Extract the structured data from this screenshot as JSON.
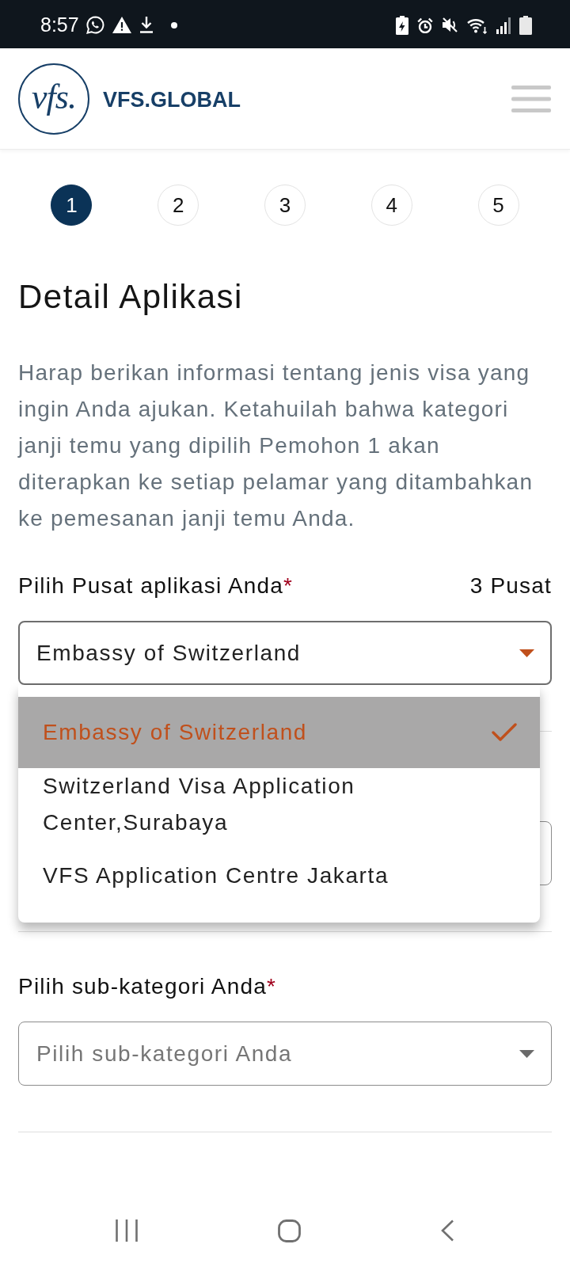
{
  "status_bar": {
    "time": "8:57"
  },
  "header": {
    "logo": "vfs.",
    "brand": "VFS.GLOBAL"
  },
  "steps": [
    {
      "label": "1",
      "selected": true
    },
    {
      "label": "2",
      "selected": false
    },
    {
      "label": "3",
      "selected": false
    },
    {
      "label": "4",
      "selected": false
    },
    {
      "label": "5",
      "selected": false
    }
  ],
  "title": "Detail Aplikasi",
  "intro": "Harap berikan informasi tentang jenis visa yang ingin Anda ajukan. Ketahuilah bahwa kategori janji temu yang dipilih Pemohon 1 akan diterapkan ke setiap pelamar yang ditambahkan ke pemesanan janji temu Anda.",
  "fields": [
    {
      "kind": "select",
      "label": "Pilih Pusat aplikasi Anda",
      "required_mark": "*",
      "count": "3 Pusat",
      "value": "Embassy of Switzerland",
      "expanded": true,
      "options": [
        {
          "label": "Embassy of Switzerland",
          "selected": true
        },
        {
          "label": "Switzerland Visa Application Center,Surabaya",
          "selected": false
        },
        {
          "label": "VFS Application Centre Jakarta",
          "selected": false
        }
      ]
    },
    {
      "kind": "select"
    },
    {
      "kind": "select",
      "label": "Pilih sub-kategori Anda",
      "required_mark": "*",
      "placeholder": "Pilih sub-kategori Anda",
      "expanded": false
    }
  ]
}
